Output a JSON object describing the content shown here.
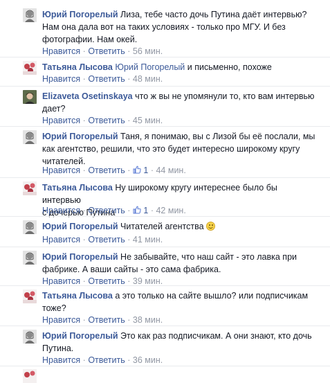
{
  "action_labels": {
    "like": "Нравится",
    "reply": "Ответить",
    "separator": "·"
  },
  "colors": {
    "link": "#3b5998",
    "meta": "#9197a3",
    "text": "#141823",
    "divider": "#e9ebee"
  },
  "comments": [
    {
      "author": "Юрий Погорелый",
      "avatar": "avatar-yuri",
      "text_1": "Лиза, тебе часто дочь Путина даёт интервью?",
      "text_2": "Нам она дала вот на таких условиях - только про МГУ. И без",
      "text_3": "фотографии. Нам окей.",
      "time": "56 мин."
    },
    {
      "author": "Татьяна Лысова",
      "avatar": "avatar-tatiana",
      "mention": "Юрий Погорелый",
      "text_1": "и письменно, похоже",
      "time": "48 мин."
    },
    {
      "author": "Elizaveta Osetinskaya",
      "avatar": "avatar-elizaveta",
      "text_1": "что ж вы не упомянули то, кто вам интервью",
      "text_2": "дает?",
      "time": "45 мин."
    },
    {
      "author": "Юрий Погорелый",
      "avatar": "avatar-yuri",
      "text_1": "Таня, я понимаю, вы с Лизой бы её послали, мы",
      "text_2": "как агентство, решили, что это будет интересно широкому кругу",
      "text_3": "читателей.",
      "likes": "1",
      "time": "44 мин."
    },
    {
      "author": "Татьяна Лысова",
      "avatar": "avatar-tatiana",
      "text_1": "Ну широкому кругу интереснее было бы интервью",
      "text_2": "с дочерью Путина",
      "likes": "1",
      "time": "42 мин."
    },
    {
      "author": "Юрий Погорелый",
      "avatar": "avatar-yuri",
      "text_1": "Читателей агентства",
      "emoji": "smiley",
      "time": "41 мин."
    },
    {
      "author": "Юрий Погорелый",
      "avatar": "avatar-yuri",
      "text_1": "Не забывайте, что наш сайт - это лавка при",
      "text_2": "фабрике. А ваши сайты - это сама фабрика.",
      "time": "39 мин."
    },
    {
      "author": "Татьяна Лысова",
      "avatar": "avatar-tatiana",
      "text_1": "а это только на сайте вышло? или подписчикам",
      "text_2": "тоже?",
      "time": "38 мин."
    },
    {
      "author": "Юрий Погорелый",
      "avatar": "avatar-yuri",
      "text_1": "Это как раз подписчикам. А они знают, кто дочь",
      "text_2": "Путина.",
      "time": "36 мин."
    }
  ]
}
